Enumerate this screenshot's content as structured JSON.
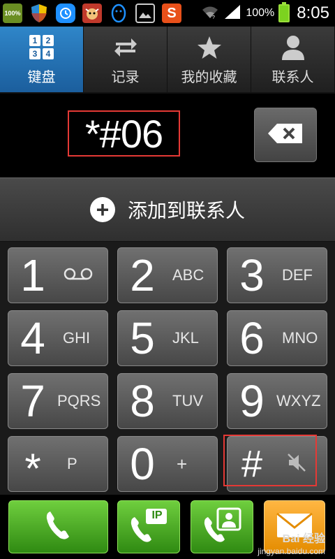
{
  "status_bar": {
    "battery_percent": "100%",
    "time": "8:05",
    "app_icons": [
      "storage-100-icon",
      "shield-icon",
      "clock-bubble-icon",
      "ox-mascot-icon",
      "qq-penguin-icon",
      "gallery-icon",
      "sogou-s-icon"
    ],
    "storage_label": "100%",
    "sogou_label": "S"
  },
  "tabs": [
    {
      "label": "键盘",
      "icon": "keypad-icon",
      "active": true
    },
    {
      "label": "记录",
      "icon": "swap-arrows-icon",
      "active": false
    },
    {
      "label": "我的收藏",
      "icon": "star-icon",
      "active": false
    },
    {
      "label": "联系人",
      "icon": "person-icon",
      "active": false
    }
  ],
  "keypad_icon_digits": [
    "1",
    "2",
    "3",
    "4"
  ],
  "display": {
    "number": "*#06"
  },
  "add_contact": {
    "label": "添加到联系人"
  },
  "keys": [
    {
      "digit": "1",
      "letters": "",
      "icon": "voicemail-icon"
    },
    {
      "digit": "2",
      "letters": "ABC"
    },
    {
      "digit": "3",
      "letters": "DEF"
    },
    {
      "digit": "4",
      "letters": "GHI"
    },
    {
      "digit": "5",
      "letters": "JKL"
    },
    {
      "digit": "6",
      "letters": "MNO"
    },
    {
      "digit": "7",
      "letters": "PQRS"
    },
    {
      "digit": "8",
      "letters": "TUV"
    },
    {
      "digit": "9",
      "letters": "WXYZ"
    },
    {
      "digit": "*",
      "letters": "P"
    },
    {
      "digit": "0",
      "letters": "+"
    },
    {
      "digit": "#",
      "letters": "",
      "icon": "mute-speaker-icon"
    }
  ],
  "actions": [
    {
      "name": "call-button",
      "icon": "phone-icon"
    },
    {
      "name": "ip-call-button",
      "icon": "ip-phone-icon",
      "badge": "IP"
    },
    {
      "name": "video-call-button",
      "icon": "video-call-icon"
    },
    {
      "name": "message-button",
      "icon": "envelope-icon"
    }
  ],
  "watermark": {
    "line1": "Bai 经验",
    "line2": "jingyan.baidu.com"
  },
  "colors": {
    "active_tab": "#1b5e9d",
    "green_button": "#3fa51a",
    "orange_button": "#f0a010",
    "highlight_box": "#e53935"
  }
}
